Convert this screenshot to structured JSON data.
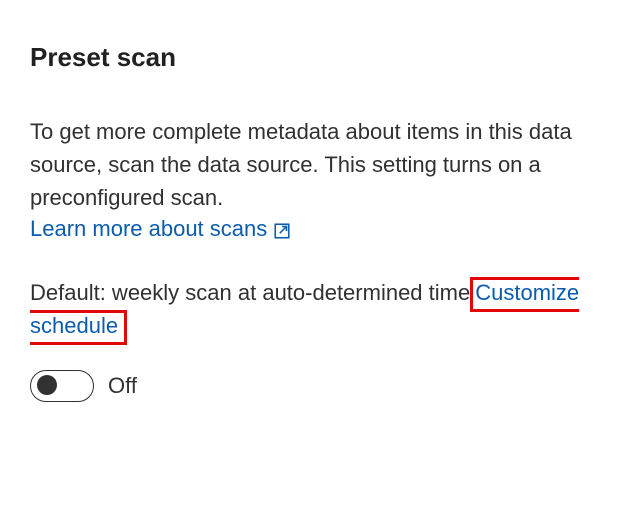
{
  "heading": "Preset scan",
  "description": "To get more complete metadata about items in this data source, scan the data source. This setting turns on a preconfigured scan.",
  "learnMore": {
    "label": "Learn more about scans"
  },
  "defaultPrefix": "Default: weekly scan at auto-determined time",
  "customizeLabel": "Customize schedule",
  "toggle": {
    "state": "Off"
  },
  "colors": {
    "link": "#0b5cad",
    "highlight": "#e40707"
  }
}
